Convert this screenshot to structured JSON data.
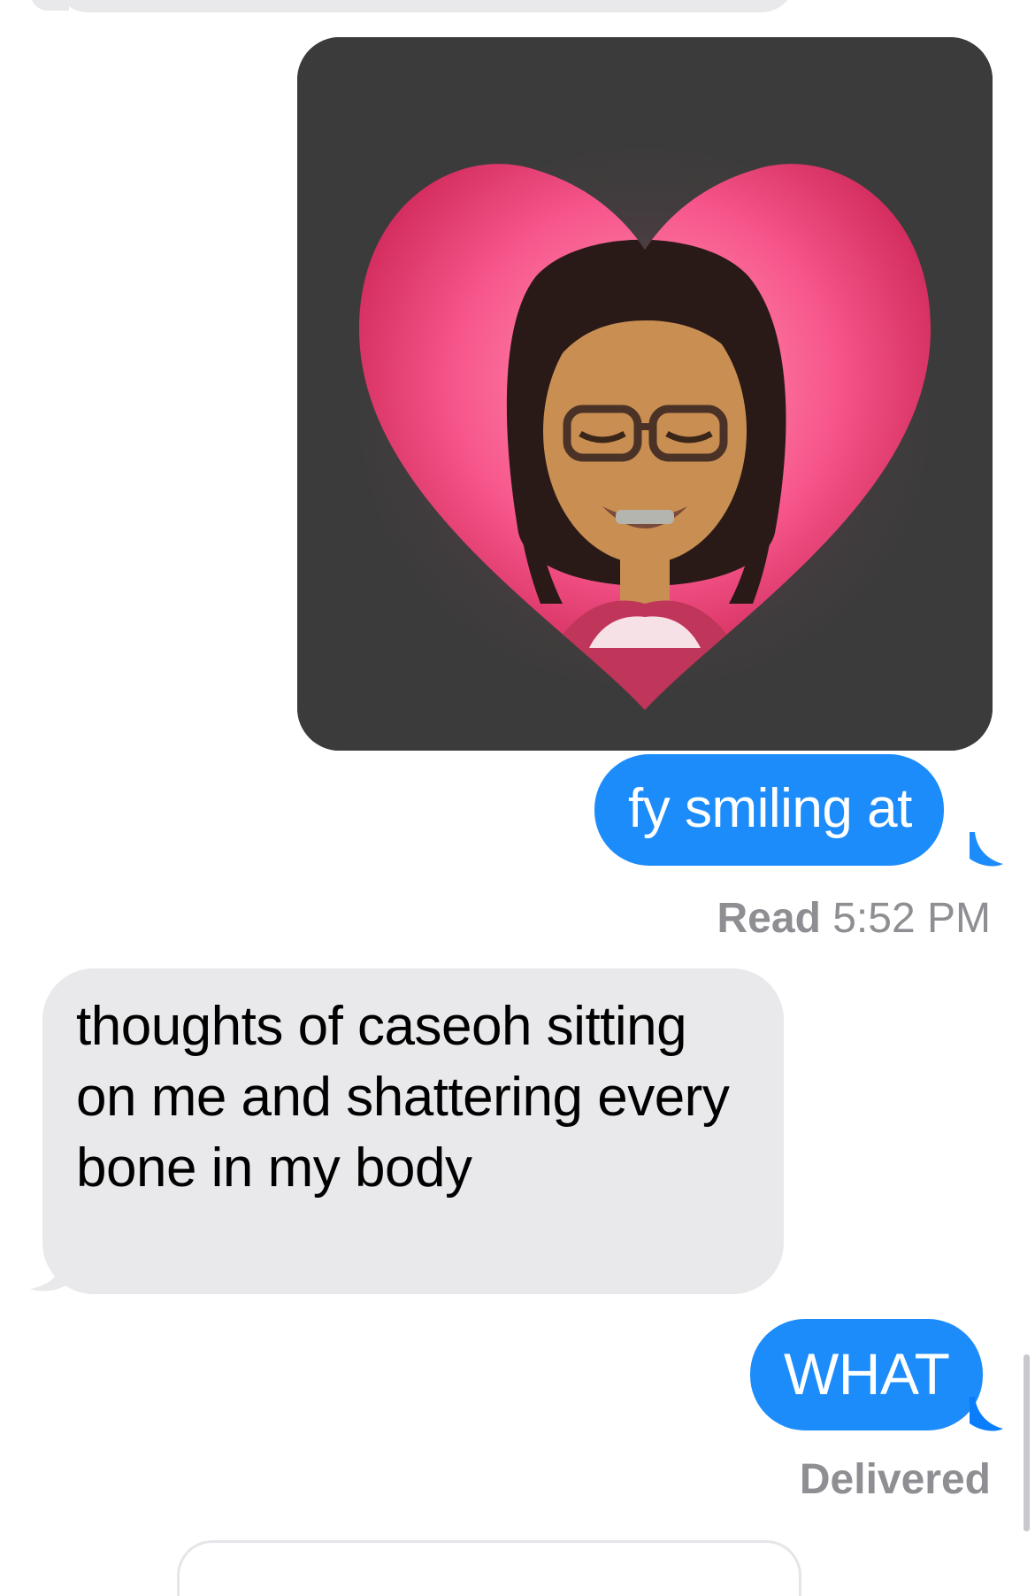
{
  "conversation": {
    "messages": [
      {
        "direction": "outgoing",
        "type": "image",
        "icon": "heart-avatar-image"
      },
      {
        "direction": "outgoing",
        "type": "text",
        "text": "fy smiling at"
      },
      {
        "direction": "incoming",
        "type": "text",
        "text": "thoughts of caseoh sitting on me and shattering every bone in my body"
      },
      {
        "direction": "outgoing",
        "type": "text",
        "text": "WHAT"
      }
    ],
    "receipt_1": {
      "status": "Read",
      "time": "5:52 PM"
    },
    "receipt_2": {
      "status": "Delivered"
    }
  },
  "colors": {
    "outgoing_bubble": "#1d8cfb",
    "incoming_bubble": "#e9e9eb",
    "receipt_text": "#8e8e93"
  }
}
